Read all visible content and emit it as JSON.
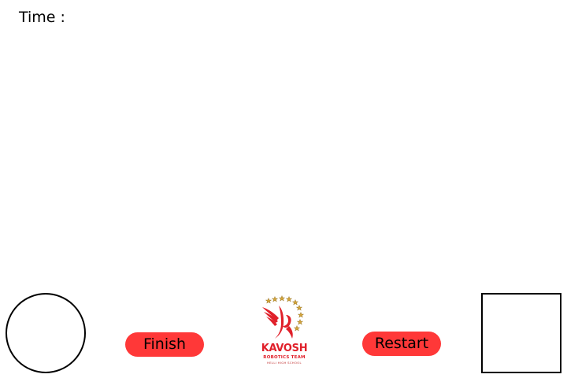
{
  "header": {
    "time_label": "Time :"
  },
  "controls": {
    "finish_label": "Finish",
    "restart_label": "Restart"
  },
  "logo": {
    "name": "KAVOSH",
    "team": "ROBOTICS TEAM",
    "school": "HELLI HIGH SCHOOL",
    "icon": "kavosh-emblem-icon"
  },
  "shapes": {
    "left": "circle-icon",
    "right": "square-icon"
  },
  "colors": {
    "button_bg": "#ff3838",
    "logo_red": "#e0202a",
    "star_gold": "#d4a53a"
  }
}
